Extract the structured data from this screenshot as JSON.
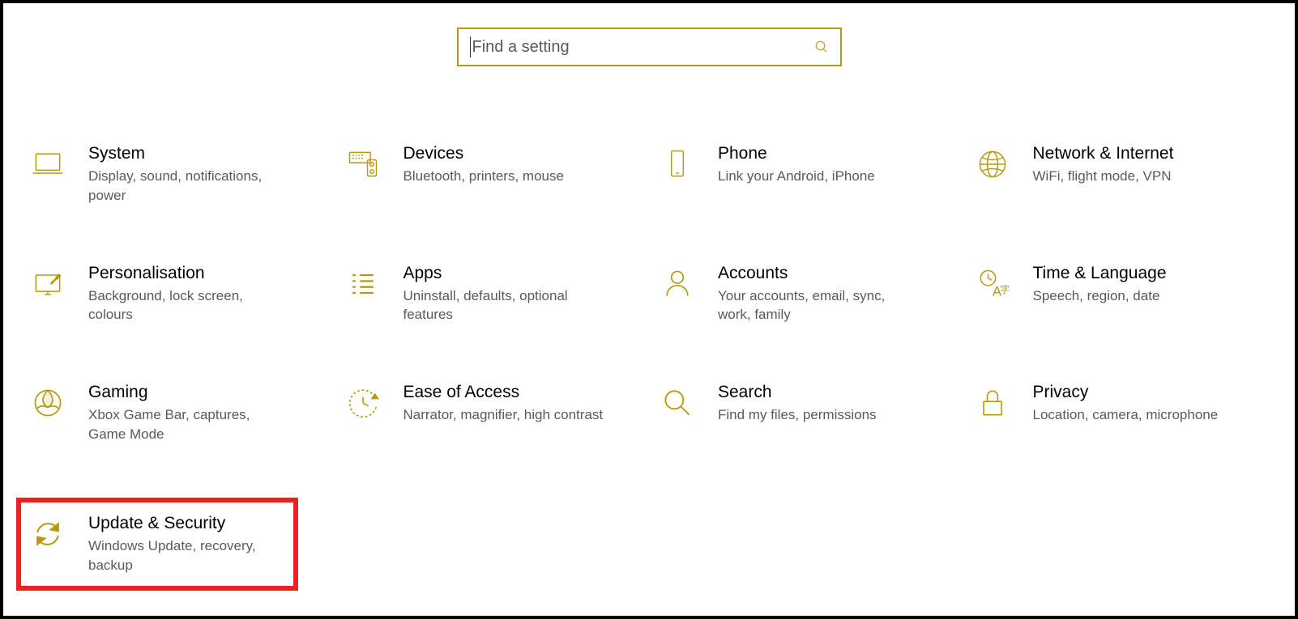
{
  "search": {
    "placeholder": "Find a setting"
  },
  "tiles": {
    "system": {
      "title": "System",
      "sub": "Display, sound, notifications, power"
    },
    "devices": {
      "title": "Devices",
      "sub": "Bluetooth, printers, mouse"
    },
    "phone": {
      "title": "Phone",
      "sub": "Link your Android, iPhone"
    },
    "network": {
      "title": "Network & Internet",
      "sub": "WiFi, flight mode, VPN"
    },
    "personalisation": {
      "title": "Personalisation",
      "sub": "Background, lock screen, colours"
    },
    "apps": {
      "title": "Apps",
      "sub": "Uninstall, defaults, optional features"
    },
    "accounts": {
      "title": "Accounts",
      "sub": "Your accounts, email, sync, work, family"
    },
    "time": {
      "title": "Time & Language",
      "sub": "Speech, region, date"
    },
    "gaming": {
      "title": "Gaming",
      "sub": "Xbox Game Bar, captures, Game Mode"
    },
    "ease": {
      "title": "Ease of Access",
      "sub": "Narrator, magnifier, high contrast"
    },
    "search": {
      "title": "Search",
      "sub": "Find my files, permissions"
    },
    "privacy": {
      "title": "Privacy",
      "sub": "Location, camera, microphone"
    },
    "update": {
      "title": "Update & Security",
      "sub": "Windows Update, recovery, backup"
    }
  },
  "colors": {
    "accent": "#b59a12",
    "highlight": "#ef2020"
  }
}
